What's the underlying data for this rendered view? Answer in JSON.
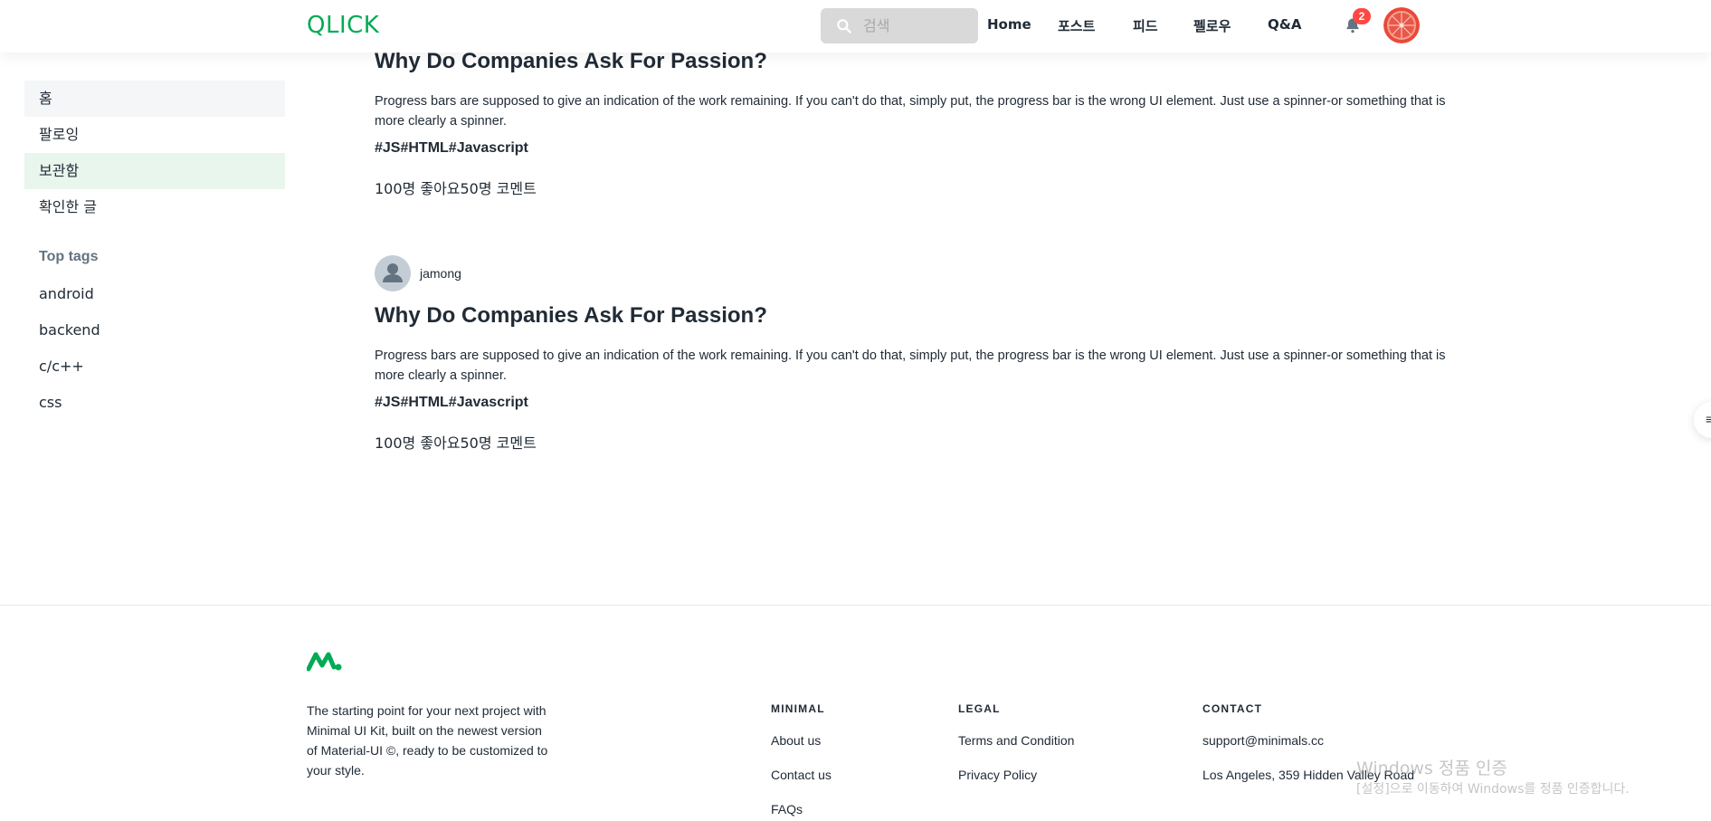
{
  "header": {
    "logo": "QLICK",
    "search_placeholder": "검색",
    "nav": [
      "Home",
      "포스트",
      "피드",
      "펠로우",
      "Q&A"
    ],
    "notification_count": "2"
  },
  "sidebar": {
    "items": [
      "홈",
      "팔로잉",
      "보관함",
      "확인한 글"
    ],
    "top_tags_heading": "Top tags",
    "tags": [
      "android",
      "backend",
      "c/c++",
      "css"
    ]
  },
  "posts": [
    {
      "title": "Why Do Companies Ask For Passion?",
      "body": "Progress bars are supposed to give an indication of the work remaining. If you can't do that, simply put, the progress bar is the wrong UI element. Just use a spinner-or something that is more clearly a spinner.",
      "tags": "#JS#HTML#Javascript",
      "stats": "100명 좋아요50명 코멘트"
    },
    {
      "author": "jamong",
      "title": "Why Do Companies Ask For Passion?",
      "body": "Progress bars are supposed to give an indication of the work remaining. If you can't do that, simply put, the progress bar is the wrong UI element. Just use a spinner-or something that is more clearly a spinner.",
      "tags": "#JS#HTML#Javascript",
      "stats": "100명 좋아요50명 코멘트"
    }
  ],
  "side_fab_glyph": "≡",
  "footer": {
    "description": "The starting point for your next project with Minimal UI Kit, built on the newest version of Material-UI ©, ready to be customized to your style.",
    "columns": [
      {
        "title": "MINIMAL",
        "links": [
          "About us",
          "Contact us",
          "FAQs"
        ]
      },
      {
        "title": "LEGAL",
        "links": [
          "Terms and Condition",
          "Privacy Policy"
        ]
      },
      {
        "title": "CONTACT",
        "links": [
          "support@minimals.cc",
          "Los Angeles, 359 Hidden Valley Road"
        ]
      }
    ]
  },
  "watermark": {
    "line1": "Windows 정품 인증",
    "line2": "[설정]으로 이동하여 Windows를 정품 인증합니다."
  },
  "colors": {
    "brand": "#00AB55",
    "badge": "#FF4842",
    "sidebar_active_bg": "#E8F6EE"
  }
}
